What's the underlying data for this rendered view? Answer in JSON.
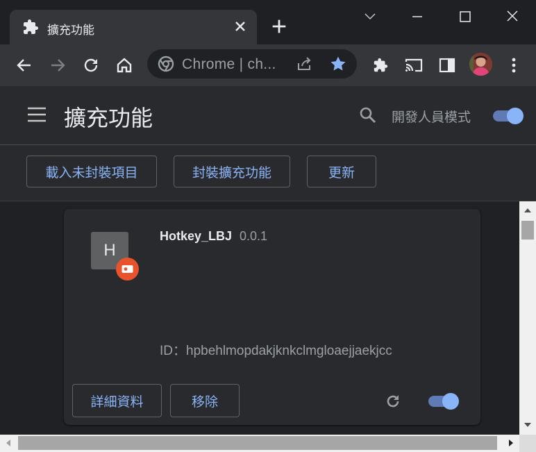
{
  "tab": {
    "title": "擴充功能"
  },
  "omnibox": {
    "text": "Chrome | ch..."
  },
  "extensions_page": {
    "title": "擴充功能",
    "developer_mode_label": "開發人員模式",
    "developer_mode_on": true,
    "actions": {
      "load_unpacked": "載入未封裝項目",
      "pack_extension": "封裝擴充功能",
      "update": "更新"
    }
  },
  "extension": {
    "icon_letter": "H",
    "name": "Hotkey_LBJ",
    "version": "0.0.1",
    "id_text": "ID：hpbehlmopdakjknkclmgloaejjaekjcc",
    "details_label": "詳細資料",
    "remove_label": "移除",
    "enabled": true
  },
  "colors": {
    "accent": "#8ab4f8",
    "badge": "#e8532b",
    "background": "#202124"
  }
}
